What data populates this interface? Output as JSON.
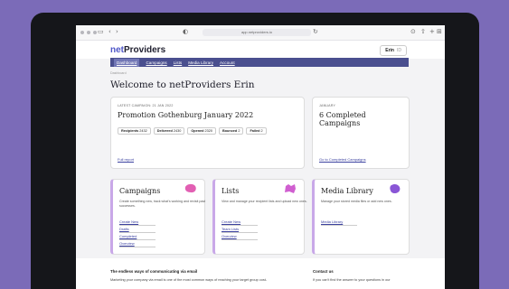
{
  "browser": {
    "url": "app.netproviders.io"
  },
  "app": {
    "logo_prefix": "net",
    "logo_suffix": "Providers",
    "user": {
      "name": "Erin",
      "tag": "ID"
    }
  },
  "nav": {
    "items": [
      "Dashboard",
      "Campaigns",
      "Lists",
      "Media Library",
      "Account"
    ]
  },
  "breadcrumb": "Dashboard",
  "page_title": "Welcome to netProviders Erin",
  "latest_campaign": {
    "label": "LATEST CAMPAIGN: 21 JAN 2022",
    "title": "Promotion Gothenburg January 2022",
    "stats": [
      {
        "label": "Recipients",
        "value": "2432"
      },
      {
        "label": "Delivered",
        "value": "2430"
      },
      {
        "label": "Opened",
        "value": "2320"
      },
      {
        "label": "Bounced",
        "value": "2"
      },
      {
        "label": "Failed",
        "value": "2"
      }
    ],
    "link": "Full report"
  },
  "completed": {
    "label": "JANUARY",
    "title": "6 Completed Campaigns",
    "link": "Go to Completed Campaigns"
  },
  "features": [
    {
      "title": "Campaigns",
      "desc": "Create something new, track what's working and revisit past successes.",
      "links": [
        "Create New",
        "Drafts",
        "Completed",
        "Overview"
      ],
      "color": "#e25fb3"
    },
    {
      "title": "Lists",
      "desc": "View and manage your recipient lists and upload new ones.",
      "links": [
        "Create New",
        "Team Lists",
        "Overview"
      ],
      "color": "#d05fd0"
    },
    {
      "title": "Media Library",
      "desc": "Manage your stored media files or add new ones.",
      "links": [
        "Media Library"
      ],
      "color": "#8a56d6"
    }
  ],
  "footer": {
    "heading1": "The endless ways of communicating via email",
    "text1": "Marketing your company via email is one of the most common ways of reaching your target group cost-",
    "heading2": "Contact us",
    "text2": "If you can't find the answer to your questions in our"
  }
}
